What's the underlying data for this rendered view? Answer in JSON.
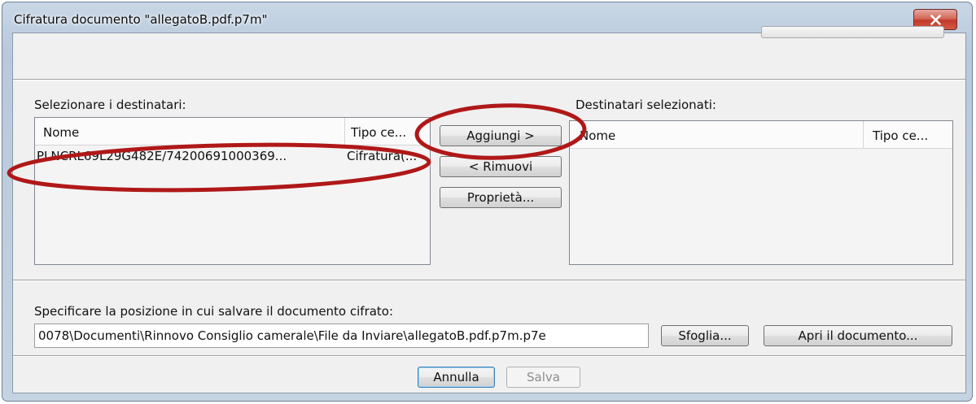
{
  "window": {
    "title": "Cifratura documento \"allegatoB.pdf.p7m\"",
    "close_icon": "close-icon"
  },
  "left_panel": {
    "label": "Selezionare i destinatari:",
    "columns": [
      "Nome",
      "Tipo ce..."
    ],
    "rows": [
      {
        "name": "PLNCRL69L29G482E/74200691000369...",
        "type": "Cifratura(..."
      }
    ]
  },
  "middle_buttons": {
    "add": "Aggiungi >",
    "remove": "< Rimuovi",
    "properties": "Proprietà..."
  },
  "right_panel": {
    "label": "Destinatari selezionati:",
    "columns": [
      "Nome",
      "Tipo ce..."
    ]
  },
  "save_location": {
    "label": "Specificare la posizione in cui salvare il documento cifrato:",
    "path": "0078\\Documenti\\Rinnovo Consiglio camerale\\File da Inviare\\allegatoB.pdf.p7m.p7e",
    "browse": "Sfoglia...",
    "open": "Apri il documento..."
  },
  "footer": {
    "cancel": "Annulla",
    "save": "Salva"
  },
  "colors": {
    "annotation": "#b01818",
    "title_bar": "#b8c9dc",
    "close_button": "#c1392a"
  }
}
